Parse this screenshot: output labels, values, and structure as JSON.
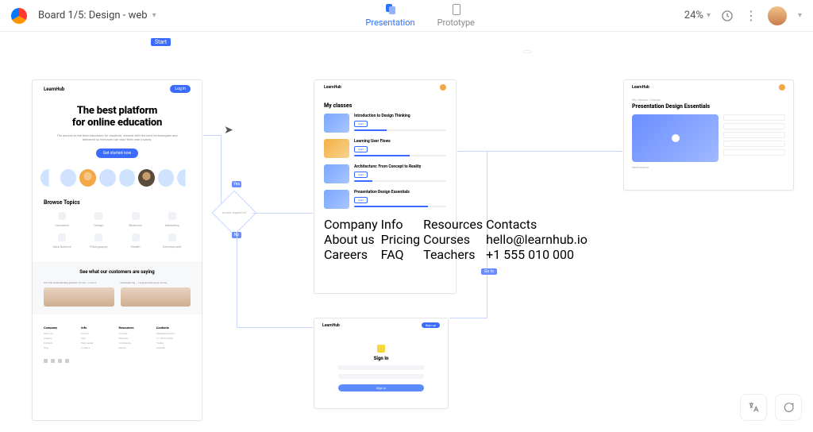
{
  "header": {
    "board_title": "Board 1/5: Design - web",
    "modes": {
      "presentation": "Presentation",
      "prototype": "Prototype"
    },
    "zoom": "24%"
  },
  "colors": {
    "accent": "#3b6bff"
  },
  "flow": {
    "start_label": "Start",
    "decision_label": "Is user signed in?",
    "yes": "Yes",
    "no": "No",
    "goto": "Go to"
  },
  "screen_landing": {
    "brand": "LearnHub",
    "nav_cta": "Log in",
    "hero_line1": "The best platform",
    "hero_line2": "for online education",
    "hero_sub": "The access to the best educators for students, created with the best technologies and delivered so everyone can start their own journey.",
    "hero_cta": "Get started now",
    "browse_heading": "Browse Topics",
    "topics": [
      "Computer",
      "Design",
      "Business",
      "Marketing",
      "Data Science",
      "Photography",
      "Health",
      "Development"
    ],
    "testimonials_heading": "See what our customers are saying",
    "testimonials": [
      {
        "quote": "It's a full understanding platform for me — I love it."
      },
      {
        "quote": "Great learning — I enjoyed here every course."
      }
    ],
    "footer_cols": [
      {
        "h": "Company",
        "links": [
          "About us",
          "Careers",
          "Partners",
          "Blog"
        ]
      },
      {
        "h": "Info",
        "links": [
          "Pricing",
          "FAQ",
          "Help center",
          "Contact"
        ]
      },
      {
        "h": "Resources",
        "links": [
          "Courses",
          "Teachers",
          "Community",
          "Events"
        ]
      },
      {
        "h": "Contacts",
        "links": [
          "hello@learnhub.io",
          "+1 555 010 000",
          "Twitter",
          "LinkedIn"
        ]
      }
    ]
  },
  "screen_classes": {
    "brand": "LearnHub",
    "title": "My classes",
    "open_label": "Open",
    "items": [
      {
        "title": "Introduction to Design Thinking",
        "progress": 35
      },
      {
        "title": "Learning User Flows",
        "progress": 60
      },
      {
        "title": "Architecture: From Concept to Reality",
        "progress": 20
      },
      {
        "title": "Presentation Design Essentials",
        "progress": 80
      }
    ]
  },
  "screen_signin": {
    "brand": "LearnHub",
    "nav_cta": "Sign up",
    "title": "Sign In",
    "button": "Sign in"
  },
  "screen_course": {
    "brand": "LearnHub",
    "breadcrumb": "My classes  ›  Course",
    "title": "Presentation Design Essentials",
    "next_label": "Next lesson"
  }
}
